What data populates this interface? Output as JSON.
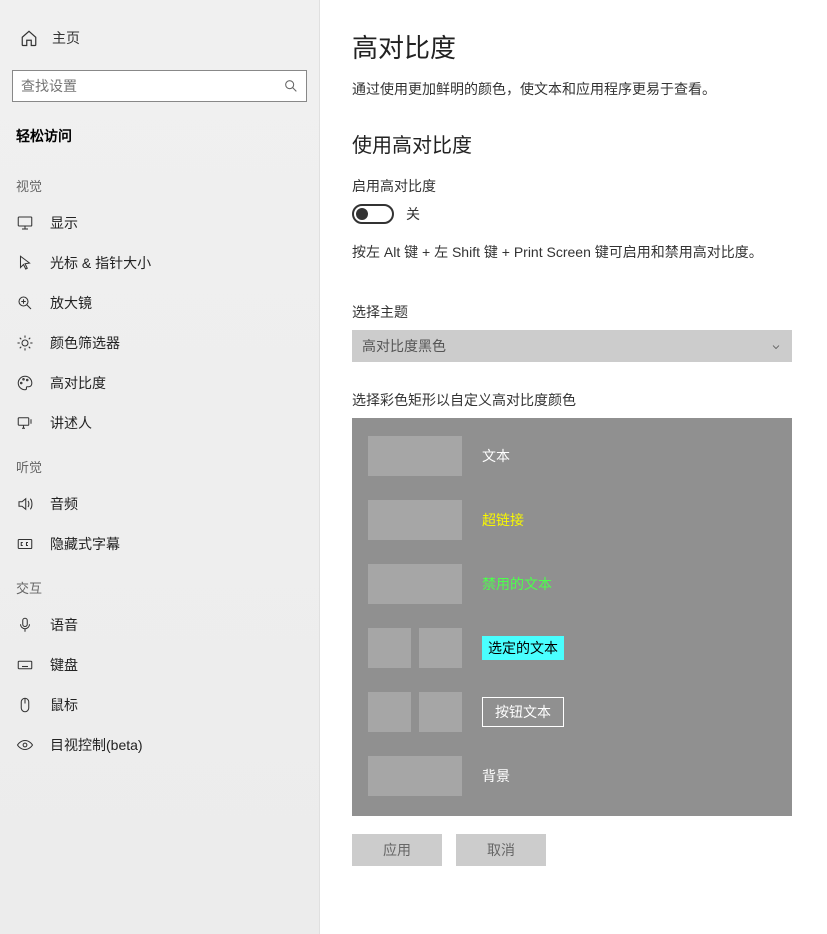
{
  "sidebar": {
    "home": "主页",
    "search_placeholder": "查找设置",
    "category": "轻松访问",
    "groups": [
      {
        "label": "视觉",
        "items": [
          {
            "id": "display",
            "label": "显示"
          },
          {
            "id": "cursor",
            "label": "光标 & 指针大小"
          },
          {
            "id": "magnifier",
            "label": "放大镜"
          },
          {
            "id": "color-filters",
            "label": "颜色筛选器"
          },
          {
            "id": "high-contrast",
            "label": "高对比度"
          },
          {
            "id": "narrator",
            "label": "讲述人"
          }
        ]
      },
      {
        "label": "听觉",
        "items": [
          {
            "id": "audio",
            "label": "音频"
          },
          {
            "id": "captions",
            "label": "隐藏式字幕"
          }
        ]
      },
      {
        "label": "交互",
        "items": [
          {
            "id": "voice",
            "label": "语音"
          },
          {
            "id": "keyboard",
            "label": "键盘"
          },
          {
            "id": "mouse",
            "label": "鼠标"
          },
          {
            "id": "eye-control",
            "label": "目视控制(beta)"
          }
        ]
      }
    ]
  },
  "main": {
    "title": "高对比度",
    "description": "通过使用更加鲜明的颜色，使文本和应用程序更易于查看。",
    "use_heading": "使用高对比度",
    "enable_label": "启用高对比度",
    "toggle_state": "关",
    "shortcut_hint": "按左 Alt 键 + 左 Shift 键 + Print Screen 键可启用和禁用高对比度。",
    "theme_label": "选择主题",
    "theme_value": "高对比度黑色",
    "colors_label": "选择彩色矩形以自定义高对比度颜色",
    "colors": {
      "text": "文本",
      "hyperlink": "超链接",
      "disabled": "禁用的文本",
      "selected": "选定的文本",
      "button": "按钮文本",
      "background": "背景"
    },
    "apply": "应用",
    "cancel": "取消"
  }
}
